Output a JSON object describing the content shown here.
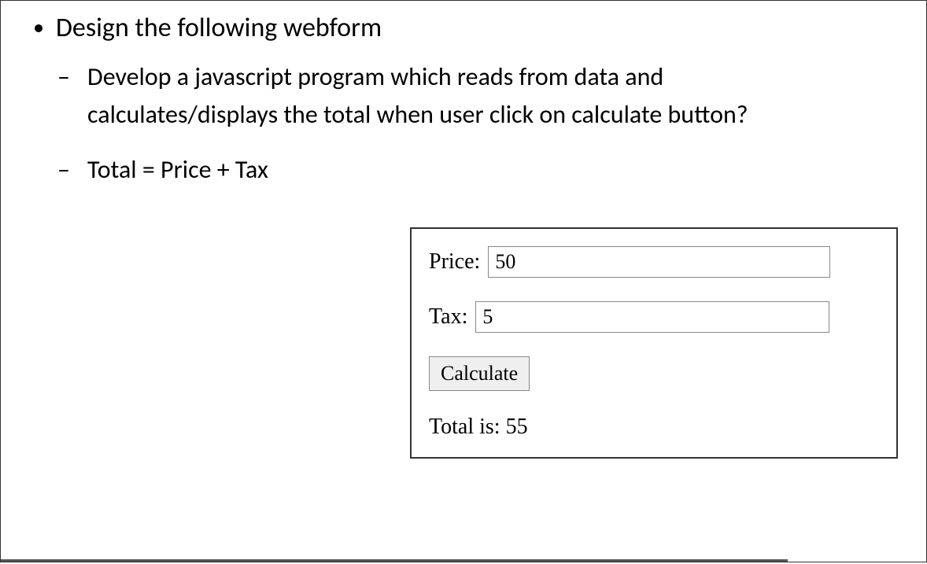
{
  "mainBullet": "Design the following webform",
  "subBullets": {
    "item1": "Develop a javascript program which reads from data and calculates/displays the total when user click on calculate button?",
    "item2": "Total = Price + Tax"
  },
  "form": {
    "priceLabel": "Price:",
    "priceValue": "50",
    "taxLabel": "Tax:",
    "taxValue": "5",
    "calculateLabel": "Calculate",
    "resultLabel": "Total is:",
    "resultValue": "55"
  }
}
